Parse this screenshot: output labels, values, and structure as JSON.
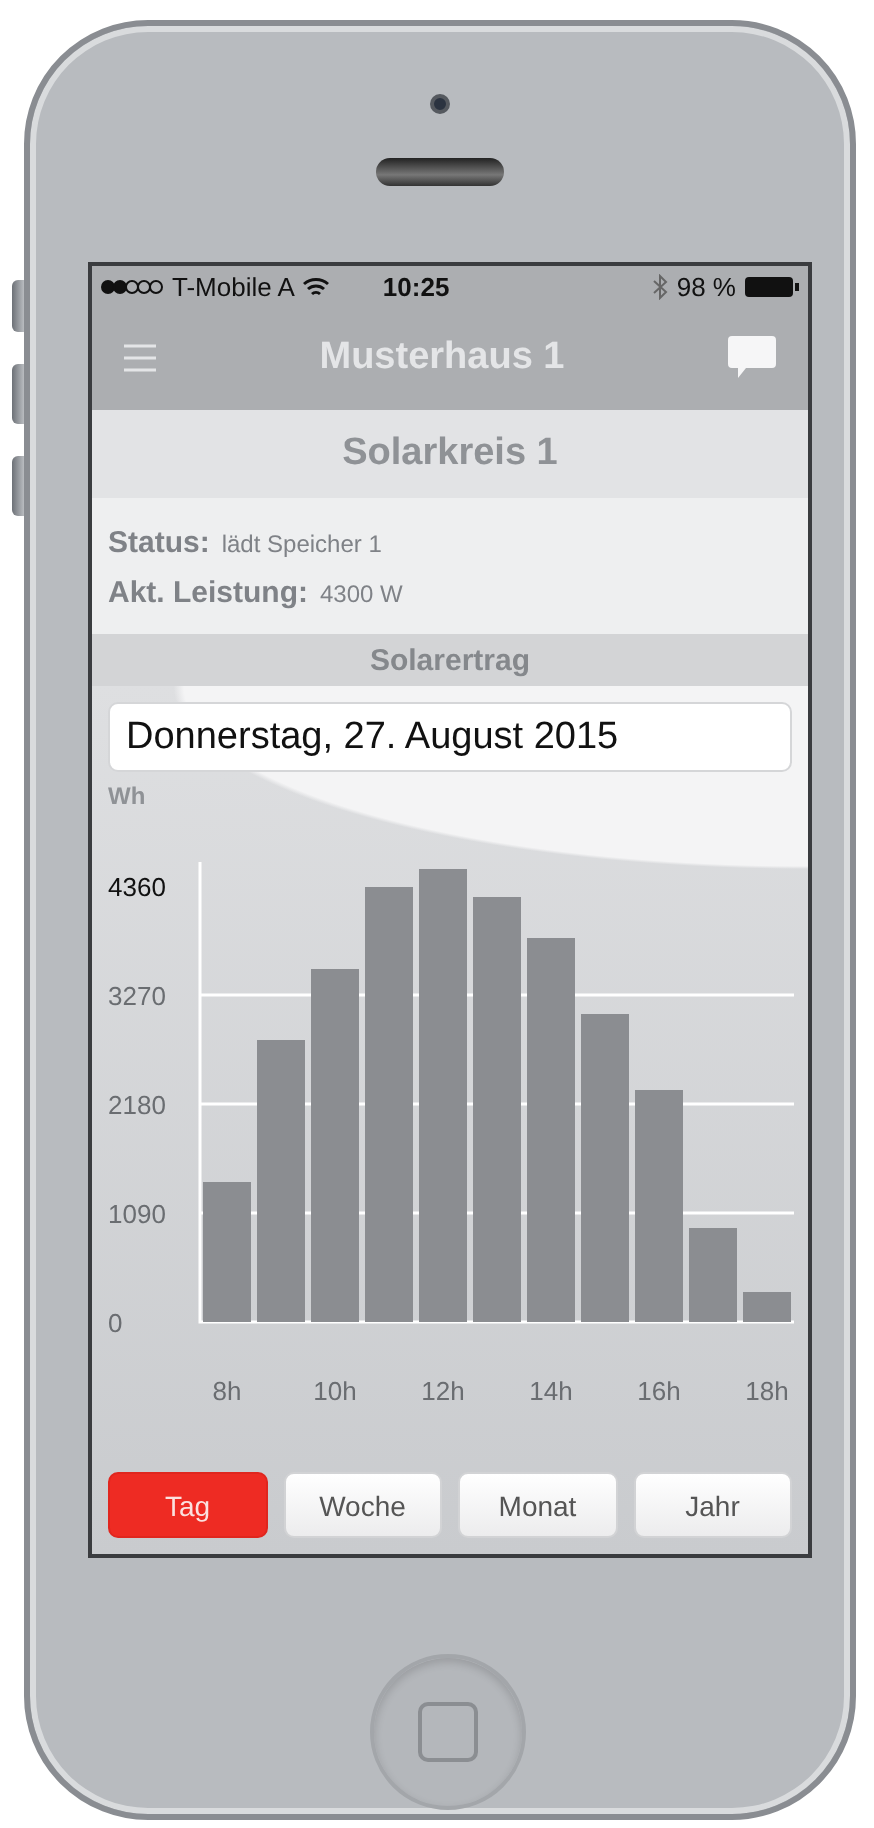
{
  "status_bar": {
    "carrier": "T-Mobile A",
    "time": "10:25",
    "battery": "98 %"
  },
  "nav_bar": {
    "title": "Musterhaus 1"
  },
  "section_title": "Solarkreis 1",
  "info": [
    {
      "label": "Status:",
      "value": "lädt Speicher 1"
    },
    {
      "label": "Akt. Leistung:",
      "value": "4300 W"
    }
  ],
  "yield_header": "Solarertrag",
  "date_field": {
    "value": "Donnerstag, 27. August 2015"
  },
  "chart": {
    "chart_data": {
      "type": "bar",
      "ylabel": "Wh",
      "x": [
        8,
        9,
        10,
        11,
        12,
        13,
        14,
        15,
        16,
        17,
        18
      ],
      "values": [
        1400,
        2820,
        3530,
        4350,
        4530,
        4250,
        3840,
        3080,
        2320,
        940,
        300
      ],
      "xlim": [
        7.5,
        18.5
      ],
      "ylim": [
        0,
        4600
      ],
      "grid": true,
      "yticks": [
        0,
        1090,
        2180,
        3270,
        4360
      ],
      "xticks": [
        {
          "value": 8,
          "label": "8h"
        },
        {
          "value": 10,
          "label": "10h"
        },
        {
          "value": 12,
          "label": "12h"
        },
        {
          "value": 14,
          "label": "14h"
        },
        {
          "value": 16,
          "label": "16h"
        },
        {
          "value": 18,
          "label": "18h"
        }
      ]
    }
  },
  "period_tabs": [
    {
      "label": "Tag",
      "selected": true
    },
    {
      "label": "Woche",
      "selected": false
    },
    {
      "label": "Monat",
      "selected": false
    },
    {
      "label": "Jahr",
      "selected": false
    }
  ]
}
